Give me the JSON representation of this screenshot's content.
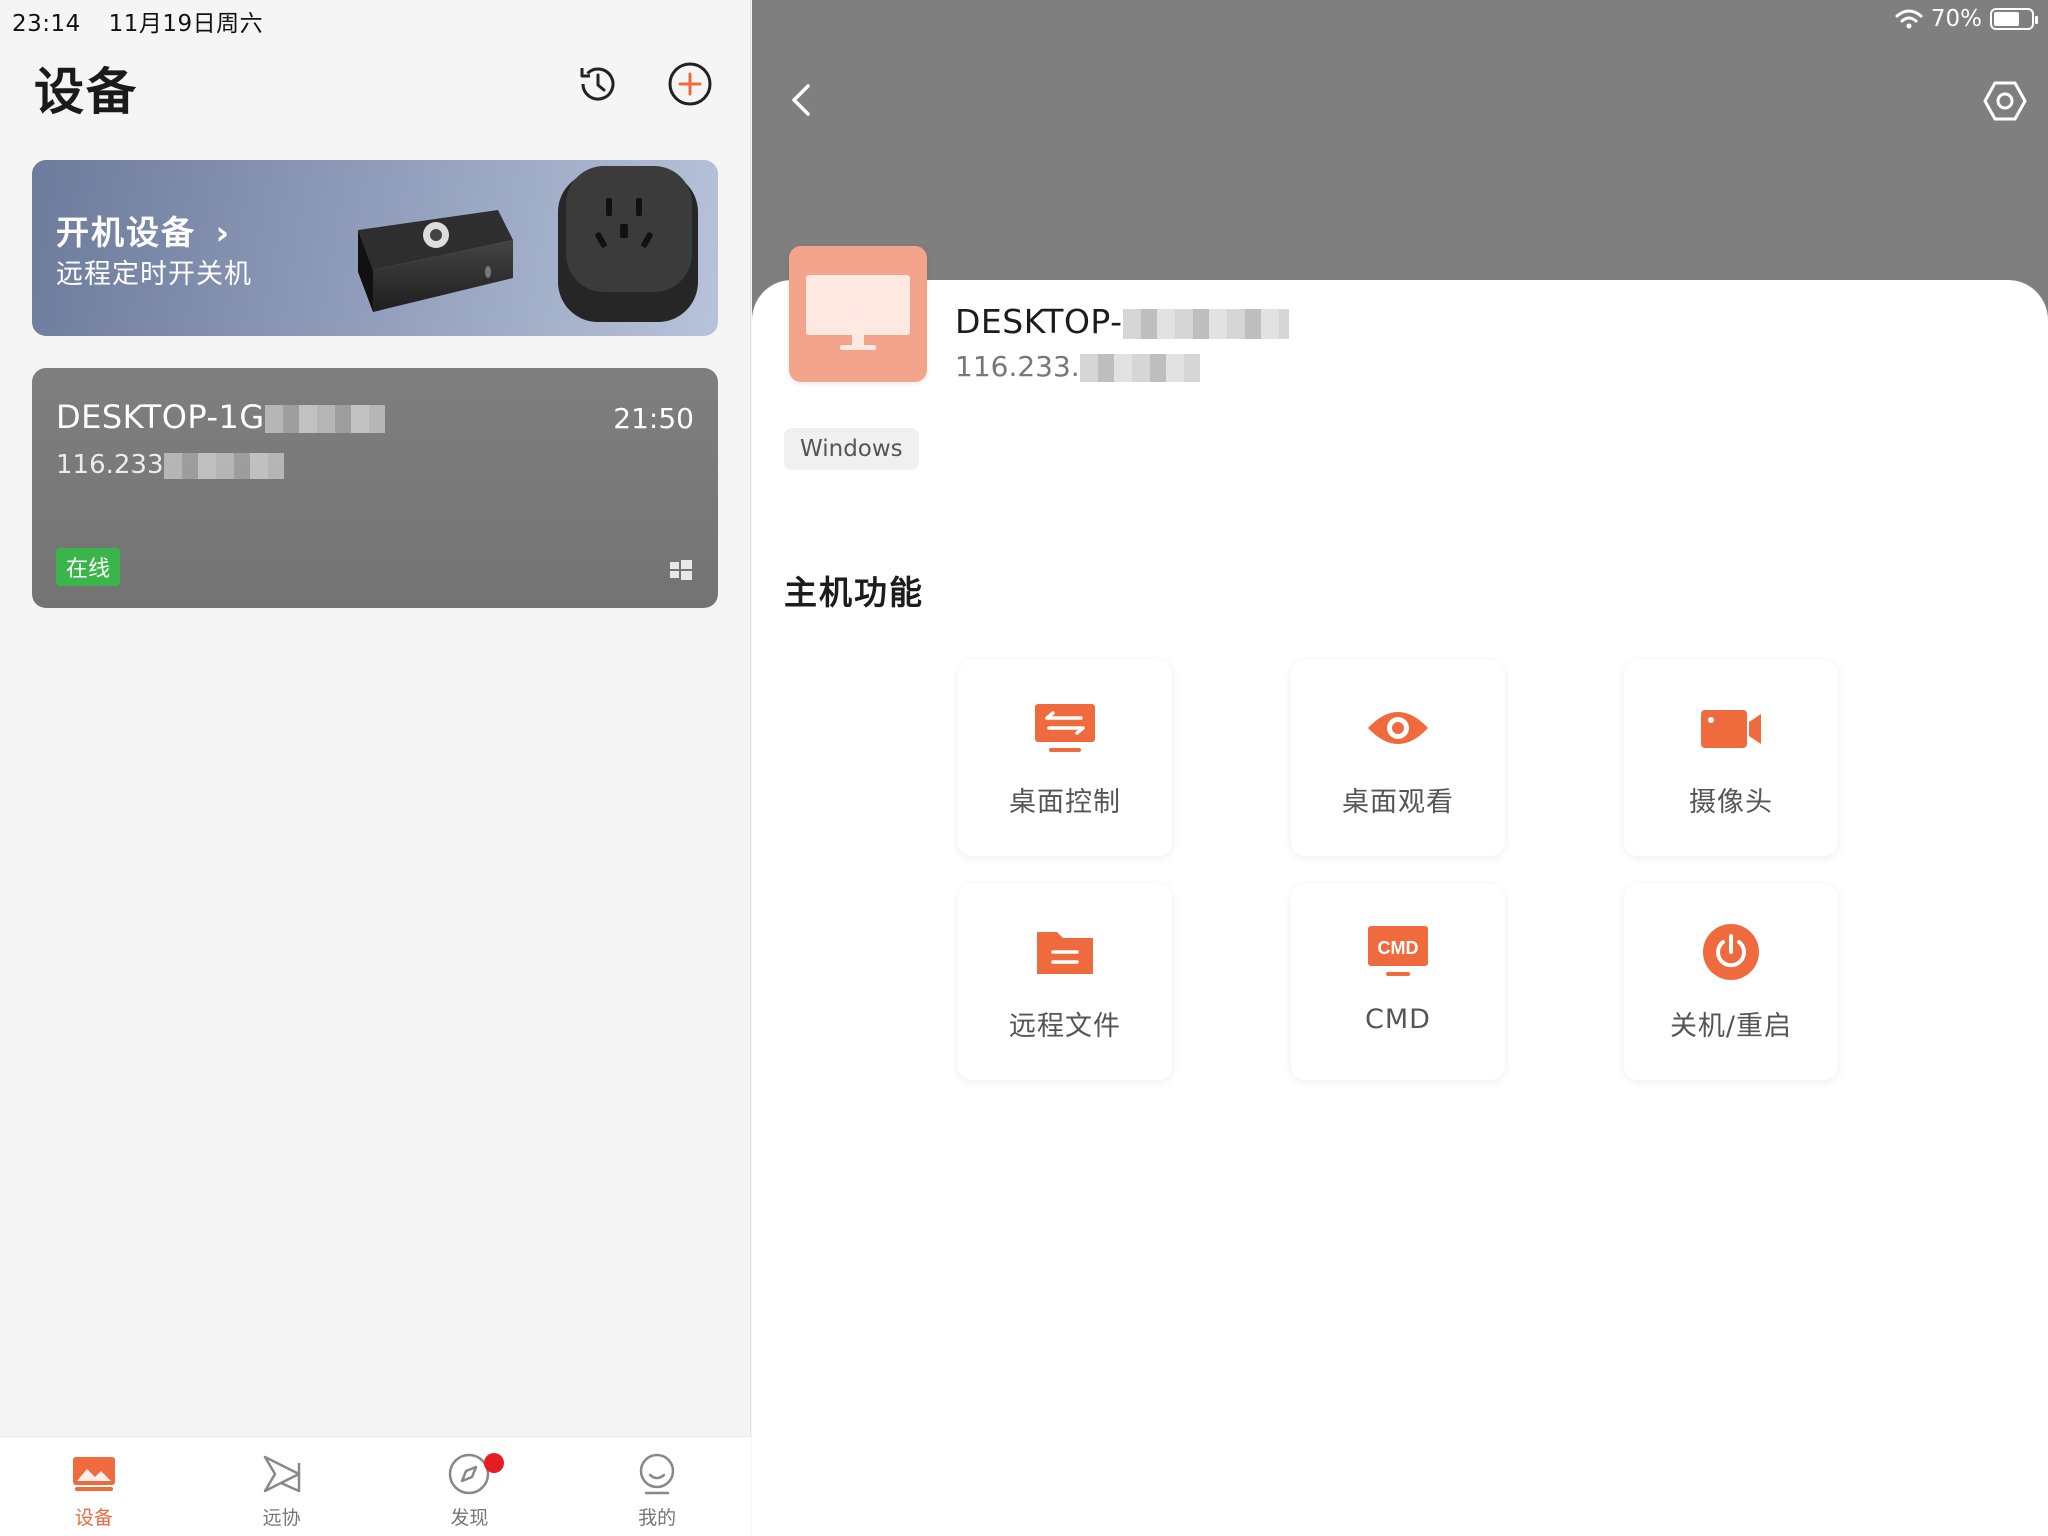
{
  "status": {
    "time": "23:14",
    "date": "11月19日周六",
    "battery": "70%",
    "battery_level": 0.7
  },
  "left": {
    "title": "设备",
    "promo": {
      "title": "开机设备",
      "subtitle": "远程定时开关机"
    },
    "device": {
      "name": "DESKTOP-1G",
      "ip": "116.233",
      "time": "21:50",
      "status": "在线"
    },
    "tabs": [
      {
        "label": "设备",
        "icon": "devices-icon",
        "active": true
      },
      {
        "label": "远协",
        "icon": "remote-assist-icon",
        "active": false
      },
      {
        "label": "发现",
        "icon": "compass-icon",
        "active": false,
        "badge": true
      },
      {
        "label": "我的",
        "icon": "profile-icon",
        "active": false
      }
    ]
  },
  "right": {
    "host": {
      "name": "DESKTOP-",
      "ip": "116.233.",
      "os": "Windows"
    },
    "section_title": "主机功能",
    "functions": [
      {
        "label": "桌面控制",
        "icon": "desktop-control-icon"
      },
      {
        "label": "桌面观看",
        "icon": "eye-icon"
      },
      {
        "label": "摄像头",
        "icon": "camera-icon"
      },
      {
        "label": "远程文件",
        "icon": "folder-icon"
      },
      {
        "label": "CMD",
        "icon": "cmd-icon"
      },
      {
        "label": "关机/重启",
        "icon": "power-icon"
      }
    ]
  },
  "colors": {
    "accent": "#ef6a3c",
    "online": "#39b54a",
    "panel_gray": "#7f7f7f"
  }
}
